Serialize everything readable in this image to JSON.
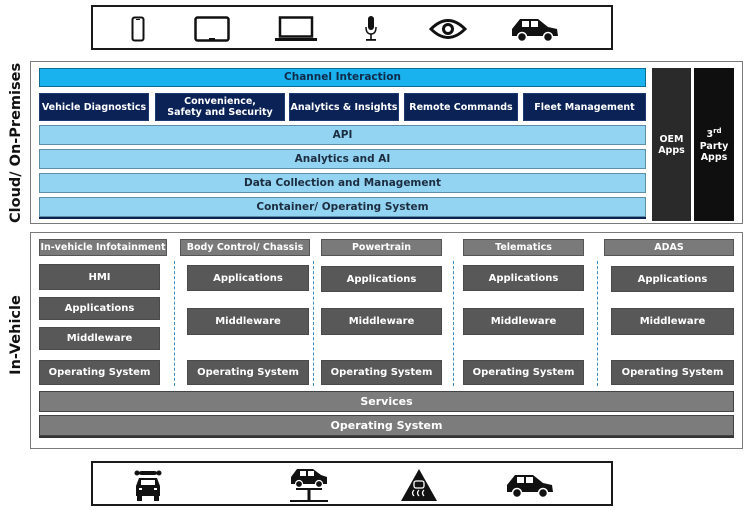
{
  "top_icons": [
    "smartphone-icon",
    "tablet-icon",
    "laptop-icon",
    "microphone-icon",
    "eye-icon",
    "car-icon"
  ],
  "bottom_icons": [
    "car-repair-icon",
    "car-lift-icon",
    "slippery-road-icon",
    "car-icon"
  ],
  "cloud": {
    "side_label": "Cloud/ On-Premises",
    "channel": "Channel Interaction",
    "services": [
      {
        "line1": "Vehicle Diagnostics",
        "line2": ""
      },
      {
        "line1": "Convenience,",
        "line2": "Safety and Security"
      },
      {
        "line1": "Analytics & Insights",
        "line2": ""
      },
      {
        "line1": "Remote Commands",
        "line2": ""
      },
      {
        "line1": "Fleet Management",
        "line2": ""
      }
    ],
    "layers": [
      "API",
      "Analytics and AI",
      "Data Collection and Management",
      "Container/ Operating System"
    ],
    "oem_apps": {
      "line1": "OEM",
      "line2": "Apps"
    },
    "third_party_apps": {
      "sup_num": "3",
      "sup": "rd",
      "line2": "Party",
      "line3": "Apps"
    }
  },
  "vehicle": {
    "side_label": "In-Vehicle",
    "domains": [
      {
        "title": "In-vehicle Infotainment",
        "items": [
          "HMI",
          "Applications",
          "Middleware",
          "Operating System"
        ]
      },
      {
        "title": "Body Control/ Chassis",
        "items": [
          "Applications",
          "Middleware",
          "Operating System"
        ]
      },
      {
        "title": "Powertrain",
        "items": [
          "Applications",
          "Middleware",
          "Operating System"
        ]
      },
      {
        "title": "Telematics",
        "items": [
          "Applications",
          "Middleware",
          "Operating System"
        ]
      },
      {
        "title": "ADAS",
        "items": [
          "Applications",
          "Middleware",
          "Operating System"
        ]
      }
    ],
    "services": "Services",
    "operating_system": "Operating System"
  },
  "colors": {
    "channel": "#1ab2ee",
    "navy": "#0b2257",
    "light_blue": "#92d4f2",
    "dark_grey": "#585858",
    "mid_grey": "#7c7c7c"
  }
}
